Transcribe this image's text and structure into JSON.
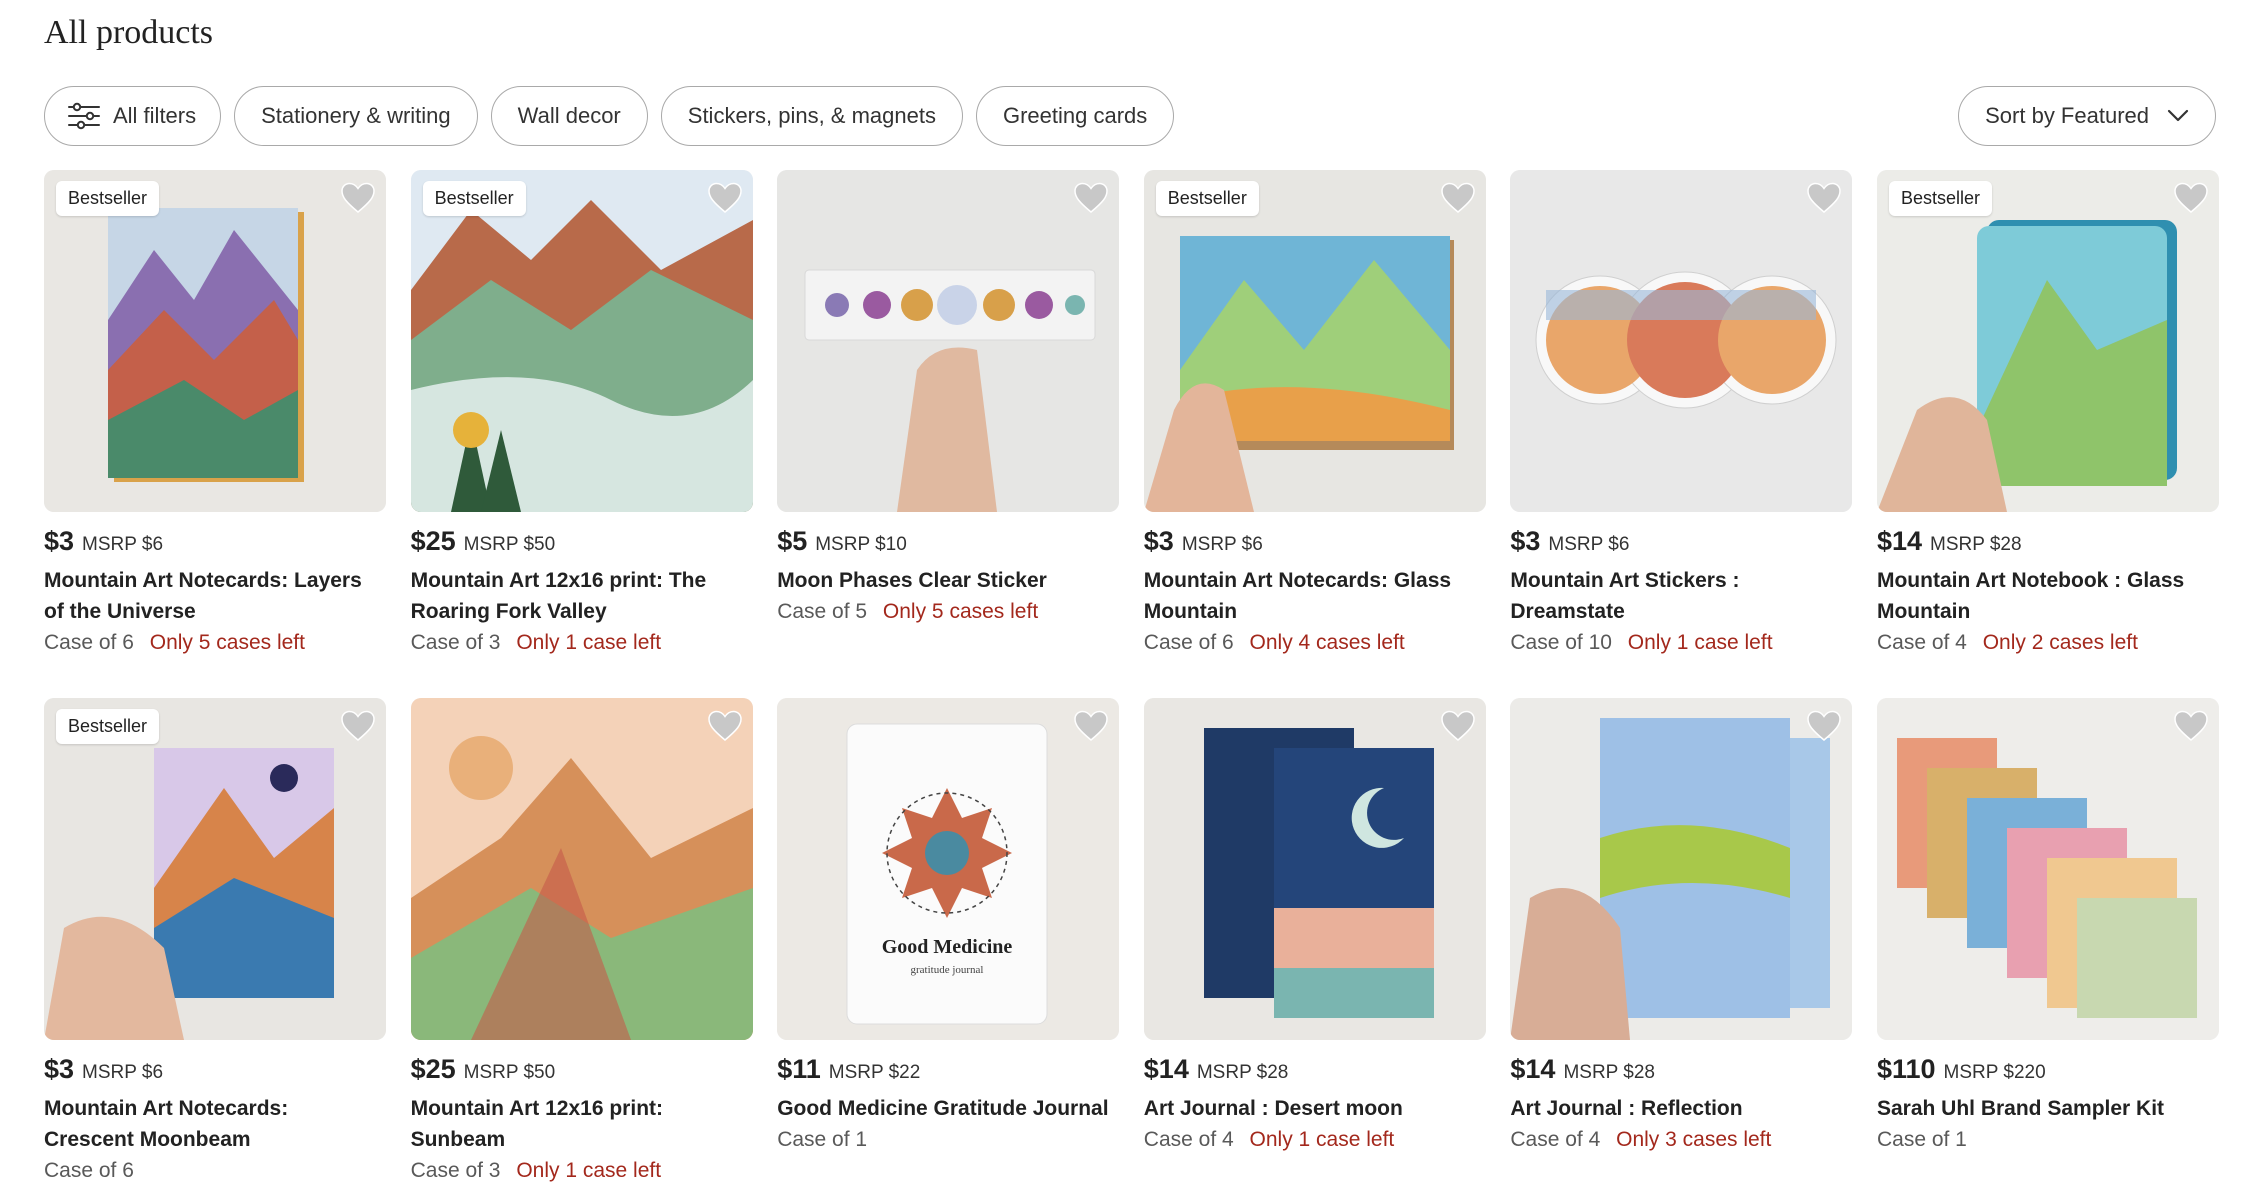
{
  "page_title": "All products",
  "filters": [
    {
      "label": "All filters",
      "icon": "sliders-icon"
    },
    {
      "label": "Stationery & writing"
    },
    {
      "label": "Wall decor"
    },
    {
      "label": "Stickers, pins, & magnets"
    },
    {
      "label": "Greeting cards"
    }
  ],
  "sort": {
    "label": "Sort by Featured",
    "icon": "chevron-down-icon"
  },
  "colors": {
    "accent_red": "#a3281c",
    "text": "#222222",
    "muted": "#595959"
  },
  "products": [
    {
      "badge": "Bestseller",
      "price": "$3",
      "msrp": "MSRP $6",
      "name_l1": "Mountain Art Notecards: Layers",
      "name_l2": "of the Universe",
      "case": "Case of 6",
      "stock": "Only 5 cases left"
    },
    {
      "badge": "Bestseller",
      "price": "$25",
      "msrp": "MSRP $50",
      "name_l1": "Mountain Art 12x16 print: The",
      "name_l2": "Roaring Fork Valley",
      "case": "Case of 3",
      "stock": "Only 1 case left"
    },
    {
      "badge": "",
      "price": "$5",
      "msrp": "MSRP $10",
      "name_l1": "Moon Phases Clear Sticker",
      "name_l2": "",
      "case": "Case of 5",
      "stock": "Only 5 cases left"
    },
    {
      "badge": "Bestseller",
      "price": "$3",
      "msrp": "MSRP $6",
      "name_l1": "Mountain Art Notecards: Glass",
      "name_l2": "Mountain",
      "case": "Case of 6",
      "stock": "Only 4 cases left"
    },
    {
      "badge": "",
      "price": "$3",
      "msrp": "MSRP $6",
      "name_l1": "Mountain Art Stickers :",
      "name_l2": "Dreamstate",
      "case": "Case of 10",
      "stock": "Only 1 case left"
    },
    {
      "badge": "Bestseller",
      "price": "$14",
      "msrp": "MSRP $28",
      "name_l1": "Mountain Art Notebook : Glass",
      "name_l2": "Mountain",
      "case": "Case of 4",
      "stock": "Only 2 cases left"
    },
    {
      "badge": "Bestseller",
      "price": "$3",
      "msrp": "MSRP $6",
      "name_l1": "Mountain Art Notecards:",
      "name_l2": "Crescent Moonbeam",
      "case": "Case of 6",
      "stock": ""
    },
    {
      "badge": "",
      "price": "$25",
      "msrp": "MSRP $50",
      "name_l1": "Mountain Art 12x16 print:",
      "name_l2": "Sunbeam",
      "case": "Case of 3",
      "stock": "Only 1 case left"
    },
    {
      "badge": "",
      "price": "$11",
      "msrp": "MSRP $22",
      "name_l1": "Good Medicine Gratitude Journal",
      "name_l2": "",
      "case": "Case of 1",
      "stock": "",
      "image_text_l1": "Good Medicine",
      "image_text_l2": "gratitude journal"
    },
    {
      "badge": "",
      "price": "$14",
      "msrp": "MSRP $28",
      "name_l1": "Art Journal : Desert moon",
      "name_l2": "",
      "case": "Case of 4",
      "stock": "Only 1 case left"
    },
    {
      "badge": "",
      "price": "$14",
      "msrp": "MSRP $28",
      "name_l1": "Art Journal : Reflection",
      "name_l2": "",
      "case": "Case of 4",
      "stock": "Only 3 cases left"
    },
    {
      "badge": "",
      "price": "$110",
      "msrp": "MSRP $220",
      "name_l1": "Sarah Uhl Brand Sampler Kit",
      "name_l2": "",
      "case": "Case of 1",
      "stock": ""
    }
  ]
}
